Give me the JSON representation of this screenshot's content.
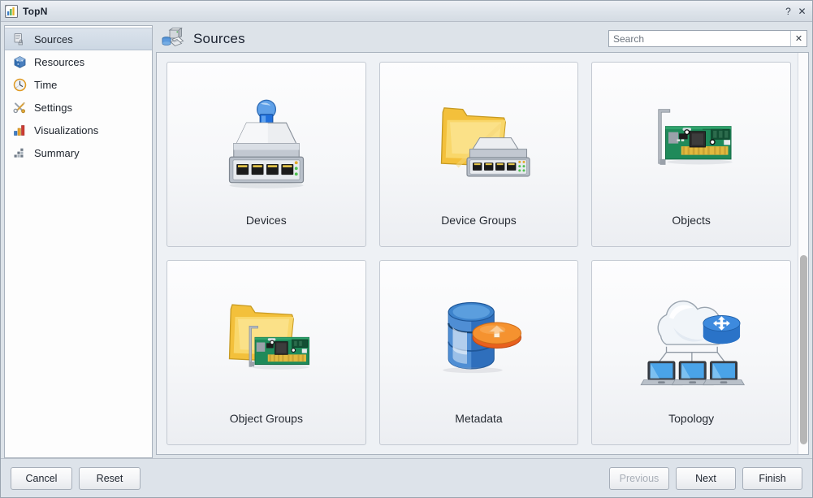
{
  "window": {
    "title": "TopN",
    "title_icon": "chart-icon",
    "help_label": "?",
    "close_label": "✕"
  },
  "sidebar": {
    "items": [
      {
        "label": "Sources",
        "icon": "sources-icon",
        "selected": true
      },
      {
        "label": "Resources",
        "icon": "resources-icon",
        "selected": false
      },
      {
        "label": "Time",
        "icon": "clock-icon",
        "selected": false
      },
      {
        "label": "Settings",
        "icon": "settings-icon",
        "selected": false
      },
      {
        "label": "Visualizations",
        "icon": "bar-chart-icon",
        "selected": false
      },
      {
        "label": "Summary",
        "icon": "summary-icon",
        "selected": false
      }
    ]
  },
  "header": {
    "title": "Sources",
    "icon": "sources-large-icon"
  },
  "search": {
    "value": "",
    "placeholder": "Search",
    "clear_label": "✕"
  },
  "tiles": [
    {
      "label": "Devices",
      "icon": "network-switch-info-icon"
    },
    {
      "label": "Device Groups",
      "icon": "folder-switch-icon"
    },
    {
      "label": "Objects",
      "icon": "pci-card-icon"
    },
    {
      "label": "Object Groups",
      "icon": "folder-pci-card-icon"
    },
    {
      "label": "Metadata",
      "icon": "database-icon"
    },
    {
      "label": "Topology",
      "icon": "cloud-network-icon"
    }
  ],
  "footer": {
    "left_buttons": [
      {
        "label": "Cancel",
        "disabled": false
      },
      {
        "label": "Reset",
        "disabled": false
      }
    ],
    "right_buttons": [
      {
        "label": "Previous",
        "disabled": true
      },
      {
        "label": "Next",
        "disabled": false
      },
      {
        "label": "Finish",
        "disabled": false
      }
    ]
  },
  "colors": {
    "accent": "#3b7cc4",
    "folder": "#f5c23e",
    "pcb_green": "#1f8a5a",
    "window_bg": "#dde3ea",
    "selection": "#ccd7e3"
  }
}
